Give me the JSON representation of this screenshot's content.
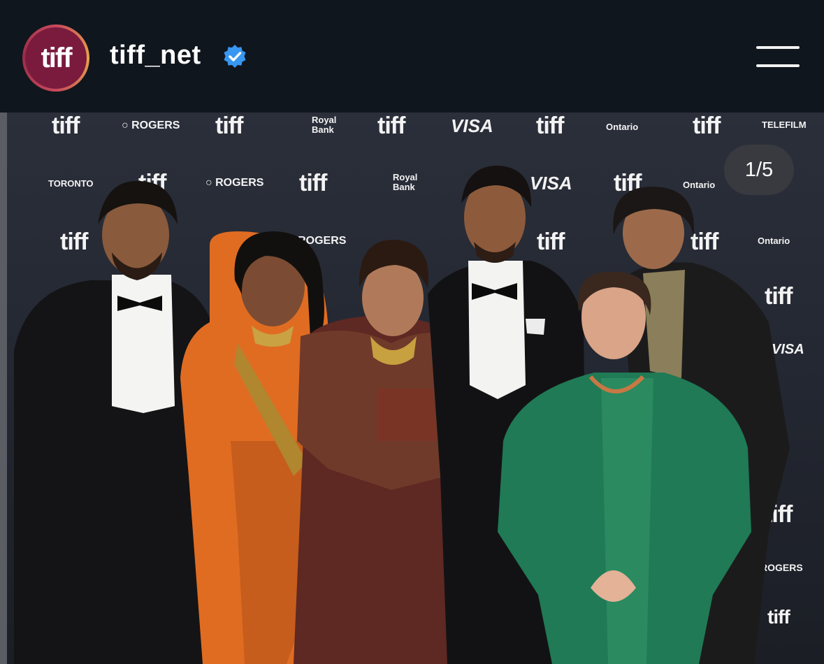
{
  "header": {
    "avatar_text": "tiff",
    "username": "tiff_net",
    "verified_icon": "verified-badge-icon",
    "menu_icon": "hamburger-menu-icon"
  },
  "post": {
    "image_counter": "1/5",
    "backdrop_logos": {
      "tiff": "tiff",
      "rogers": "ROGERS",
      "royal_bank": "Royal Bank",
      "visa": "VISA",
      "ontario": "Ontario",
      "telefilm": "TELEFILM",
      "toronto": "TORONTO"
    }
  },
  "colors": {
    "header_bg": "#10161d",
    "avatar_bg": "#7a1b3d",
    "verified_blue": "#3897f0",
    "backdrop": "#2b2f3a"
  }
}
